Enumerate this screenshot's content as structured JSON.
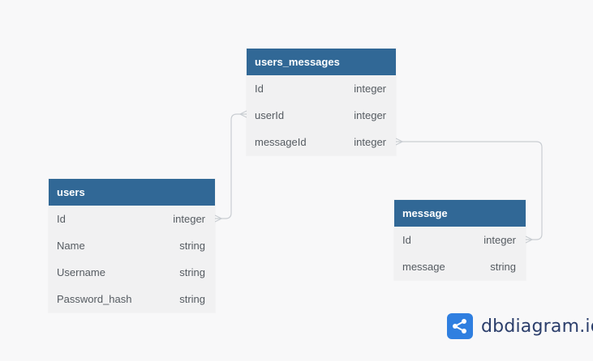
{
  "tables": [
    {
      "name": "users",
      "fields": [
        {
          "name": "Id",
          "type": "integer"
        },
        {
          "name": "Name",
          "type": "string"
        },
        {
          "name": "Username",
          "type": "string"
        },
        {
          "name": "Password_hash",
          "type": "string"
        }
      ]
    },
    {
      "name": "users_messages",
      "fields": [
        {
          "name": "Id",
          "type": "integer"
        },
        {
          "name": "userId",
          "type": "integer"
        },
        {
          "name": "messageId",
          "type": "integer"
        }
      ]
    },
    {
      "name": "message",
      "fields": [
        {
          "name": "Id",
          "type": "integer"
        },
        {
          "name": "message",
          "type": "string"
        }
      ]
    }
  ],
  "relations": [
    {
      "from": "users.Id",
      "to": "users_messages.userId"
    },
    {
      "from": "users_messages.messageId",
      "to": "message.Id"
    }
  ],
  "brand": {
    "name": "dbdiagram",
    "suffix": ".io"
  },
  "colors": {
    "header": "#316896",
    "body": "#f1f1f2",
    "background": "#f8f8f9",
    "link": "#c9cdd2",
    "brand_icon": "#2f7fe0"
  }
}
